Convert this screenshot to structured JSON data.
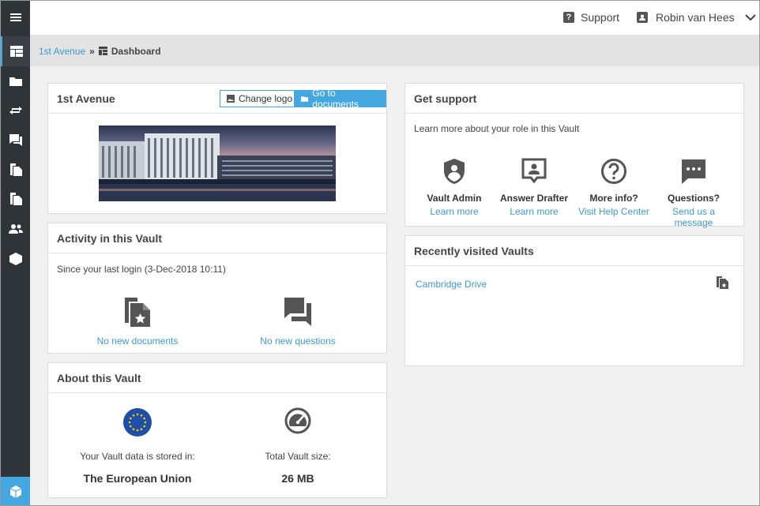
{
  "topbar": {
    "support_label": "Support",
    "user_name": "Robin van Hees"
  },
  "breadcrumb": {
    "parent": "1st Avenue",
    "separator": "»",
    "current": "Dashboard"
  },
  "vault_panel": {
    "title": "1st Avenue",
    "change_logo_label": "Change logo",
    "go_to_documents_label": "Go to documents"
  },
  "activity_panel": {
    "title": "Activity in this Vault",
    "since_text": "Since your last login (3-Dec-2018 10:11)",
    "documents_link": "No new documents",
    "questions_link": "No new questions"
  },
  "about_panel": {
    "title": "About this Vault",
    "storage_label": "Your Vault data is stored in:",
    "storage_value": "The European Union",
    "size_label": "Total Vault size:",
    "size_value": "26 MB"
  },
  "support_panel": {
    "title": "Get support",
    "intro": "Learn more about your role in this Vault",
    "items": [
      {
        "label": "Vault Admin",
        "link": "Learn more",
        "icon": "shield-user-icon"
      },
      {
        "label": "Answer Drafter",
        "link": "Learn more",
        "icon": "presenter-icon"
      },
      {
        "label": "More info?",
        "link": "Visit Help Center",
        "icon": "question-circle-icon"
      },
      {
        "label": "Questions?",
        "link": "Send us a message",
        "icon": "chat-icon"
      }
    ]
  },
  "recent_panel": {
    "title": "Recently visited Vaults",
    "vaults": [
      {
        "name": "Cambridge Drive"
      }
    ]
  },
  "colors": {
    "accent": "#45a7e0",
    "sidebar": "#2f3438",
    "link": "#3c9ad5"
  }
}
